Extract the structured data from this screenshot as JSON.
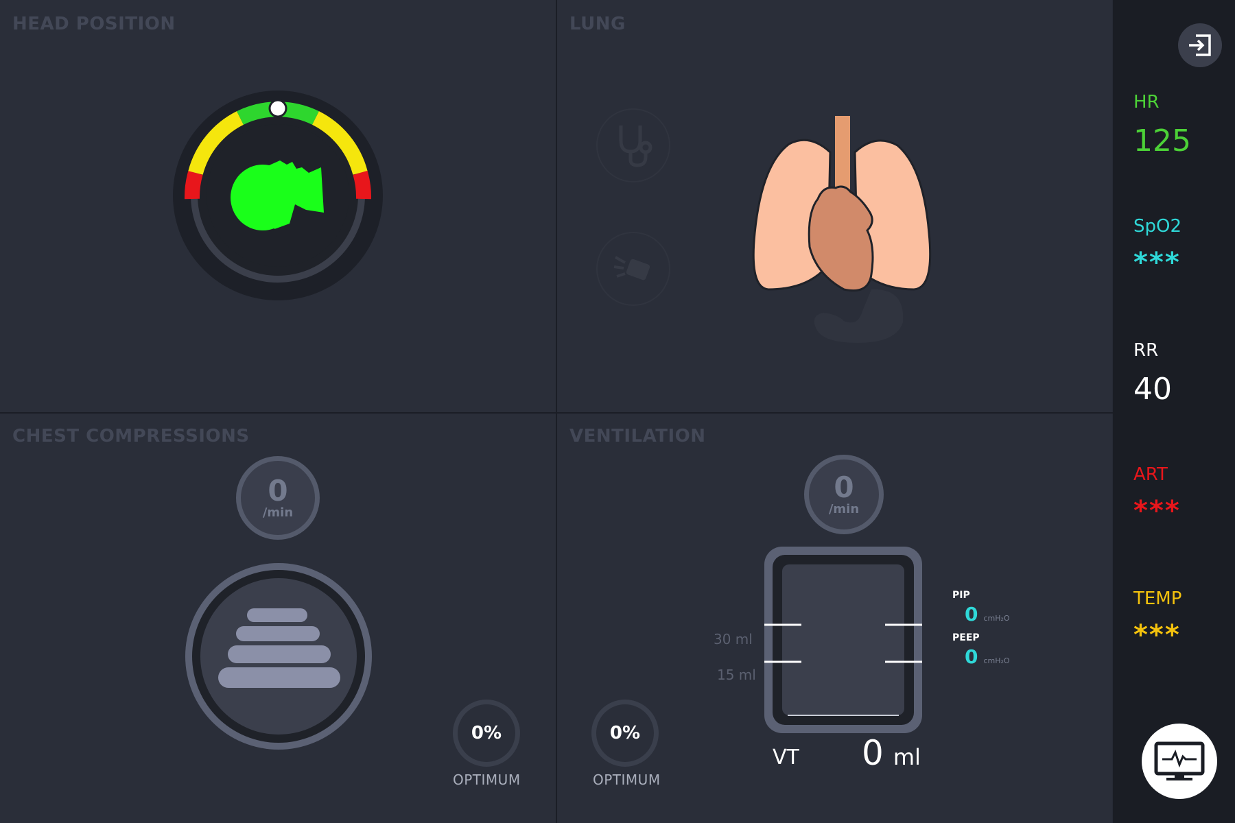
{
  "panels": {
    "head_position": {
      "title": "HEAD POSITION"
    },
    "lung": {
      "title": "LUNG"
    },
    "chest_compressions": {
      "title": "CHEST COMPRESSIONS",
      "rate_value": "0",
      "rate_unit": "/min",
      "optimum_value": "0%",
      "optimum_label": "OPTIMUM"
    },
    "ventilation": {
      "title": "VENTILATION",
      "rate_value": "0",
      "rate_unit": "/min",
      "optimum_value": "0%",
      "optimum_label": "OPTIMUM",
      "marker_30": "30 ml",
      "marker_15": "15 ml",
      "pip_label": "PIP",
      "pip_value": "0",
      "pip_unit": "cmH₂O",
      "peep_label": "PEEP",
      "peep_value": "0",
      "peep_unit": "cmH₂O",
      "vt_label": "VT",
      "vt_value": "0",
      "vt_unit": "ml"
    }
  },
  "sidebar": {
    "exit_icon": "exit-icon",
    "monitor_icon": "monitor-icon",
    "vitals": [
      {
        "label": "HR",
        "value": "125",
        "color": "#4cd137"
      },
      {
        "label": "SpO2",
        "value": "***",
        "color": "#2fd8d8"
      },
      {
        "label": "RR",
        "value": "40",
        "color": "#ffffff"
      },
      {
        "label": "ART",
        "value": "***",
        "color": "#e8161b"
      },
      {
        "label": "TEMP",
        "value": "***",
        "color": "#f4c20d"
      }
    ]
  },
  "colors": {
    "background": "#272b36",
    "sidebar": "#1a1d24",
    "head_ok": "#1aff1a",
    "zone_green": "#2ed62e",
    "zone_yellow": "#f5e60d",
    "zone_red": "#e8161b",
    "lung": "#fbbfa0",
    "heart": "#d18a6a",
    "trachea": "#e59c70"
  }
}
